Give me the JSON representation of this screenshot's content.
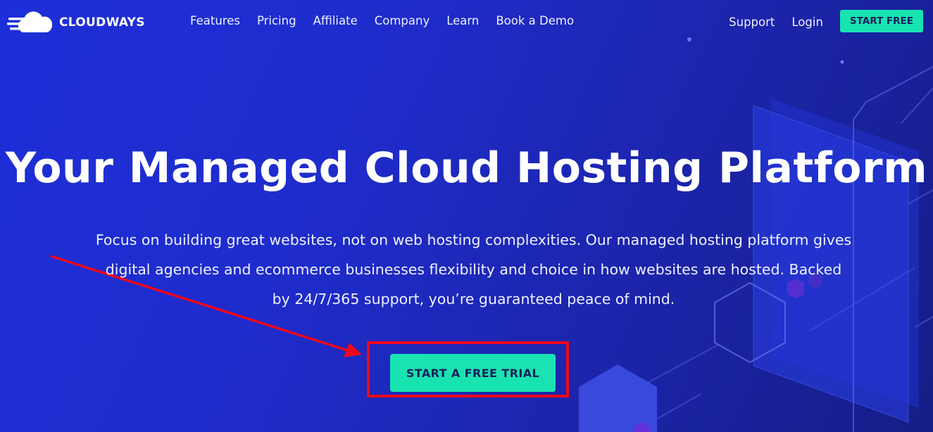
{
  "brand": {
    "name": "CLOUDWAYS"
  },
  "nav": {
    "links": [
      "Features",
      "Pricing",
      "Affiliate",
      "Company",
      "Learn",
      "Book a Demo"
    ],
    "right_links": [
      "Support",
      "Login"
    ],
    "cta_label": "START FREE"
  },
  "hero": {
    "title": "Your Managed Cloud Hosting Platform",
    "subtitle_lines": [
      "Focus on building great websites, not on web hosting complexities. Our managed hosting platform gives",
      "digital agencies and ecommerce businesses flexibility and choice in how websites are hosted. Backed",
      "by 24/7/365 support, you’re guaranteed peace of mind."
    ],
    "cta_label": "START A FREE TRIAL"
  },
  "colors": {
    "background": "#1f2ccc",
    "accent": "#19e3b1",
    "annotation_red": "#f2071a"
  }
}
